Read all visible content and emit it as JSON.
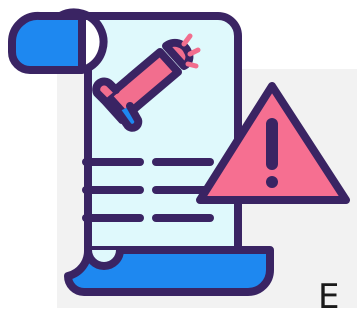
{
  "illustration": {
    "icon": "announcement-warning-icon",
    "parts": [
      "scroll-document-icon",
      "megaphone-icon",
      "text-lines",
      "warning-triangle-icon"
    ],
    "colors": {
      "outline": "#3a2463",
      "paper": "#dff9fc",
      "roll_blue": "#1e88f0",
      "pink": "#f26e8e",
      "warning_fill": "#f66f91",
      "panel": "#f2f2f2"
    }
  },
  "corner_text": "E"
}
